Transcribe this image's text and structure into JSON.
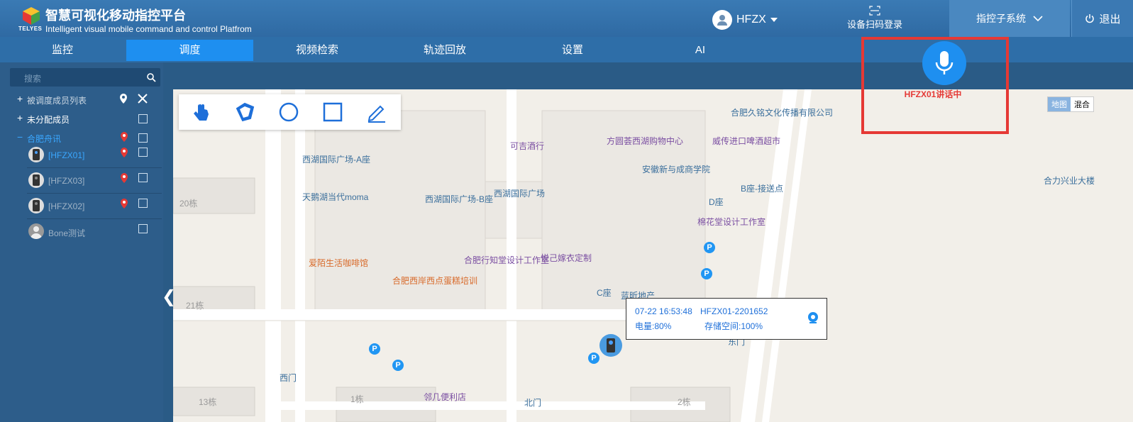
{
  "header": {
    "title": "智慧可视化移动指控平台",
    "subtitle": "Intelligent visual mobile command and control Platfrom",
    "logo_text": "TELYES",
    "user": "HFZX",
    "scan_login": "设备扫码登录",
    "subsystem": "指控子系统",
    "logout": "退出"
  },
  "nav": {
    "items": [
      "监控",
      "调度",
      "视频检索",
      "轨迹回放",
      "设置",
      "AI"
    ],
    "active": "调度"
  },
  "sidebar": {
    "search_placeholder": "搜索",
    "dispatched_list": "被调度成员列表",
    "unassigned": "未分配成员",
    "group": "合肥舟讯",
    "members": [
      {
        "name": "[HFZX01]",
        "status": "online"
      },
      {
        "name": "[HFZX03]",
        "status": "offline"
      },
      {
        "name": "[HFZX02]",
        "status": "offline"
      },
      {
        "name": "Bone测试",
        "status": "offline"
      }
    ]
  },
  "map": {
    "map_type": {
      "map": "地图",
      "hybrid": "混合",
      "active": "地图"
    },
    "labels": [
      "西湖国际广场-A座",
      "天鹅湖当代moma",
      "西湖国际广场-B座",
      "西湖国际广场",
      "可吉酒行",
      "方圆荟西湖购物中心",
      "威传进口啤酒超市",
      "合肥久铭文化传播有限公司",
      "安徽新与成商学院",
      "D座",
      "B座-接送点",
      "棉花堂设计工作室",
      "悦己嫁衣定制",
      "合肥行知堂设计工作室",
      "爱陌生活咖啡馆",
      "合肥西岸西点蛋糕培训",
      "C座",
      "蓝昕地产",
      "合力兴业大楼",
      "20栋",
      "21栋",
      "13栋",
      "1栋",
      "2栋",
      "西门",
      "北门",
      "邻几便利店",
      "东门"
    ]
  },
  "ptt": {
    "label": "HFZX01讲话中"
  },
  "info_window": {
    "time": "07-22 16:53:48",
    "device_id": "HFZX01-2201652",
    "battery": "电量:80%",
    "storage": "存储空间:100%"
  }
}
